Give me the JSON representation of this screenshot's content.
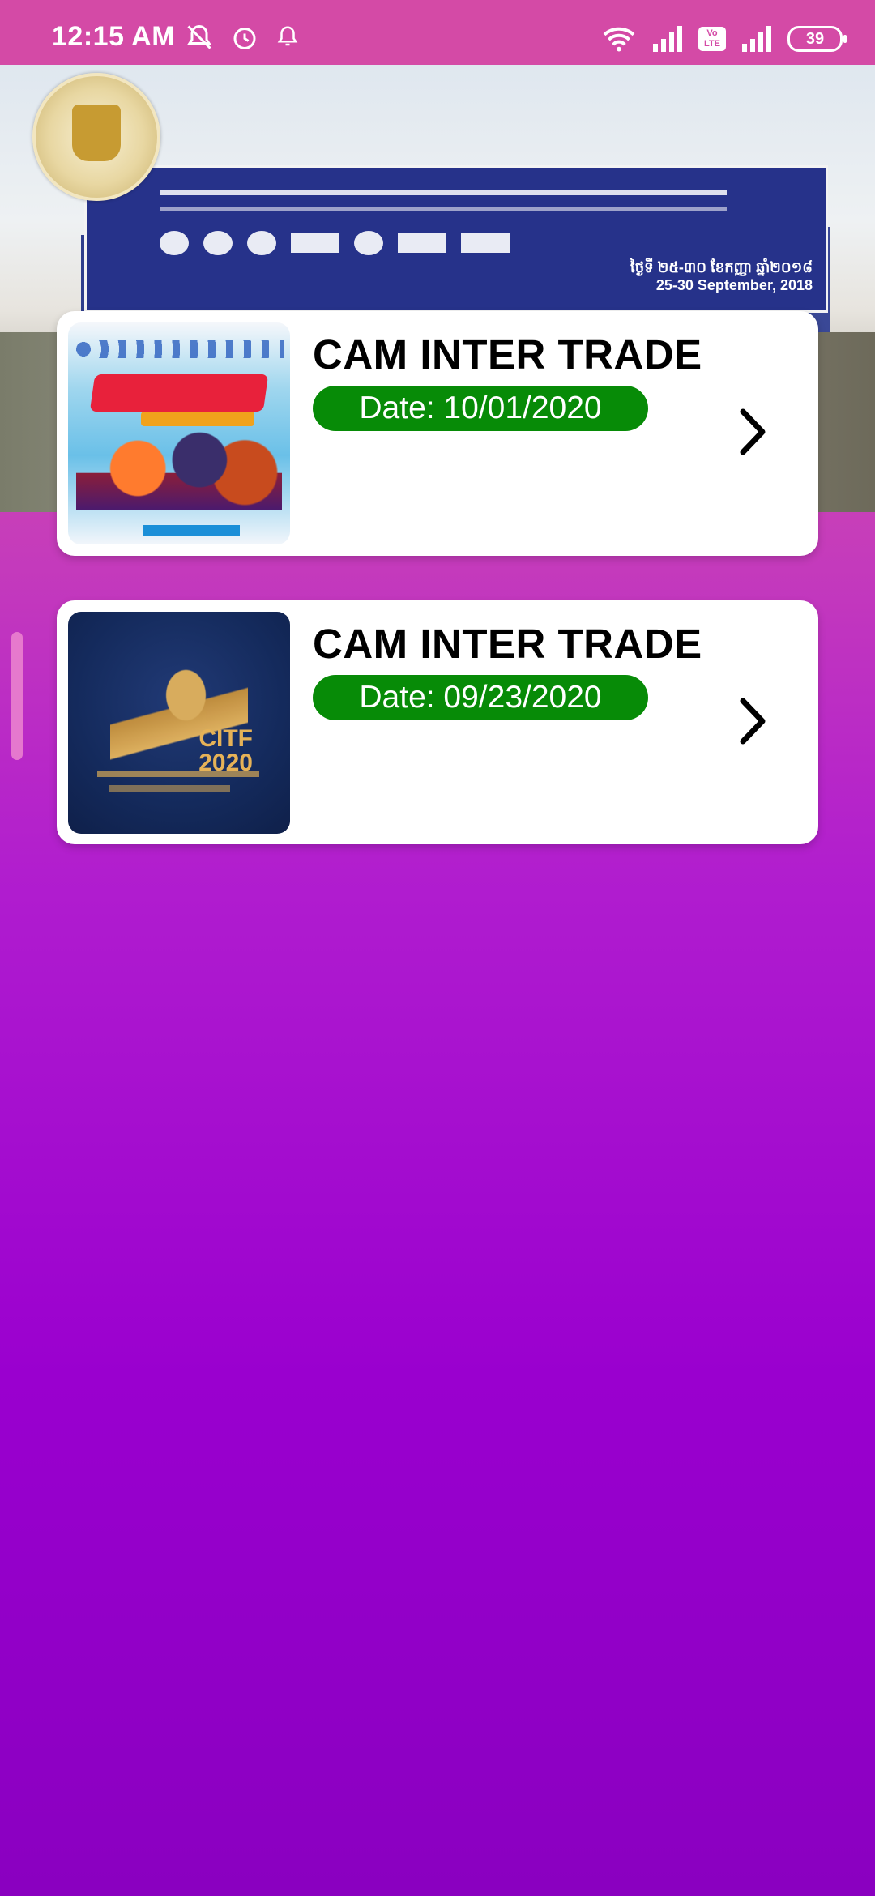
{
  "status_bar": {
    "time": "12:15 AM",
    "battery": "39",
    "volte_top": "Vo",
    "volte_bottom": "LTE",
    "icons": [
      "mute-icon",
      "alarm-icon",
      "bell-icon",
      "wifi-icon",
      "signal-icon",
      "volte-icon",
      "signal-icon",
      "battery-icon"
    ]
  },
  "banner": {
    "date_line1": "ថ្ងៃទី ២៥-៣០ ខែកញ្ញា ឆ្នាំ២០១៨",
    "date_line2": "25-30 September, 2018"
  },
  "events": [
    {
      "title": "CAM INTER TRADE",
      "date": "Date: 10/01/2020",
      "thumb_icon": "cam-inter-trade-poster-2020"
    },
    {
      "title": "CAM INTER TRADE",
      "date": "Date: 09/23/2020",
      "thumb_icon": "citf-2020-poster",
      "thumb_text": "CITF\n2020"
    }
  ],
  "colors": {
    "status_bar": "#d44aa6",
    "date_pill": "#078b07",
    "gradient_top": "#d94aa8",
    "gradient_bottom": "#8a00c0"
  }
}
